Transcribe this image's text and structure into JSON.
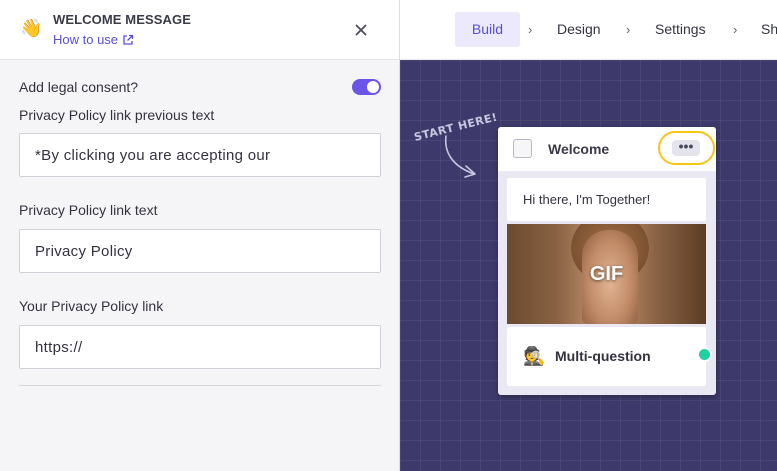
{
  "panel": {
    "title": "WELCOME MESSAGE",
    "how_to_use": "How to use",
    "close_label": "×",
    "consent_label": "Add legal consent?",
    "consent_enabled": true,
    "fields": [
      {
        "label": "Privacy Policy link previous text",
        "value": "*By clicking you are accepting our"
      },
      {
        "label": "Privacy Policy link text",
        "value": "Privacy Policy"
      },
      {
        "label": "Your Privacy Policy link",
        "value": "https://"
      }
    ]
  },
  "nav": {
    "items": [
      "Build",
      "Design",
      "Settings",
      "Sh"
    ],
    "separator": "›",
    "active": "Build"
  },
  "canvas": {
    "start_here": "START HERE!",
    "card": {
      "title": "Welcome",
      "menu_label": "•••",
      "message": "Hi there, I'm Together!",
      "gif_label": "GIF",
      "question_icon": "🕵",
      "question_label": "Multi-question"
    }
  },
  "colors": {
    "accent": "#6a55e8",
    "canvas_bg": "#3d3a6b",
    "highlight": "#f5c518",
    "connector": "#1fd1a0"
  }
}
